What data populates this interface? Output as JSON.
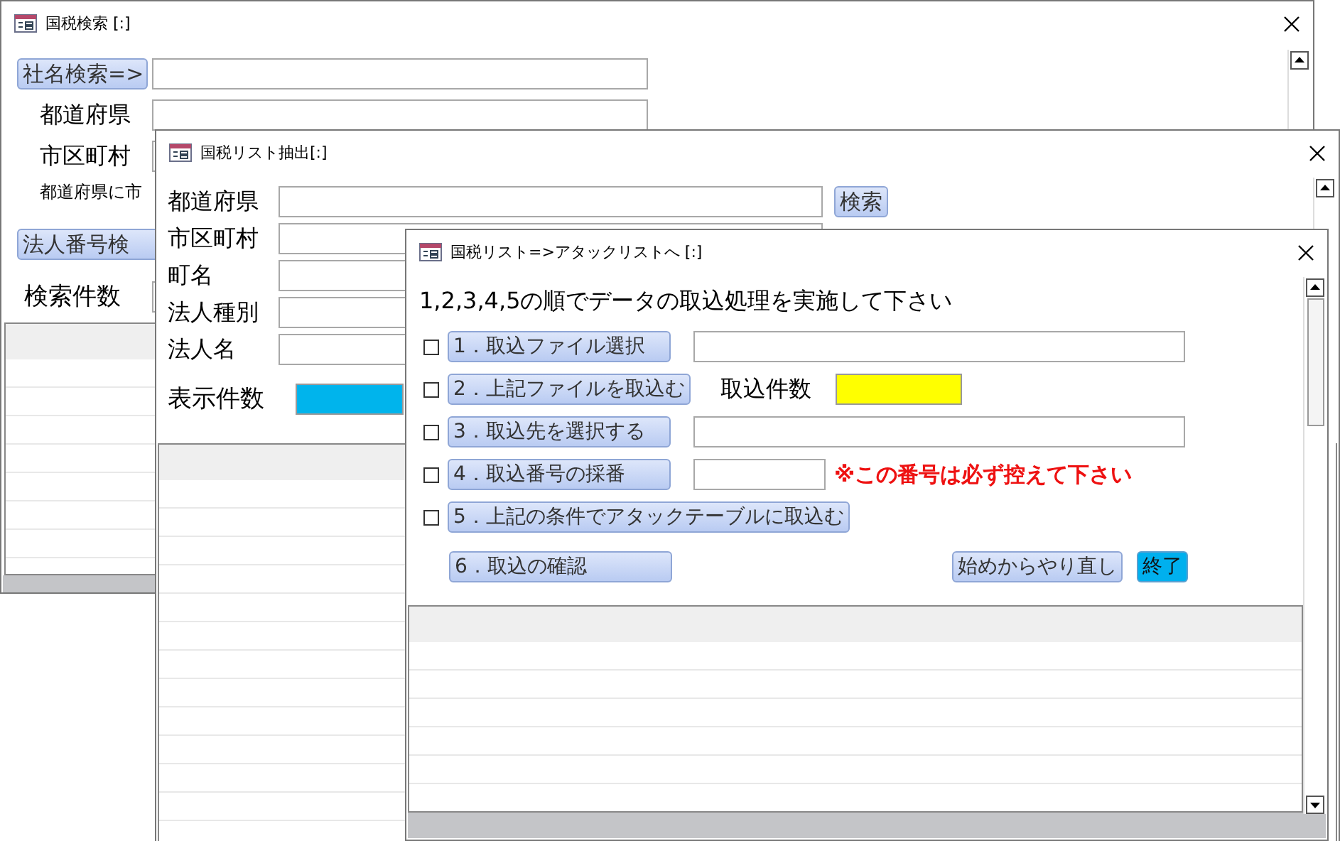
{
  "search_window": {
    "title": "国税検索 [:]",
    "company_search_button": "社名検索=>",
    "fields": [
      {
        "label": "都道府県"
      },
      {
        "label": "市区町村"
      }
    ],
    "note": "都道府県に市",
    "corporate_number_button": "法人番号検",
    "count_label": "検索件数"
  },
  "extract_window": {
    "title": "国税リスト抽出[:]",
    "fields": [
      {
        "label": "都道府県"
      },
      {
        "label": "市区町村"
      },
      {
        "label": "町名"
      },
      {
        "label": "法人種別"
      },
      {
        "label": "法人名"
      }
    ],
    "search_button": "検索",
    "count_label": "表示件数"
  },
  "import_window": {
    "title": "国税リスト=>アタックリストへ [:]",
    "instruction": "1,2,3,4,5の順でデータの取込処理を実施して下さい",
    "steps": [
      {
        "label": "1．取込ファイル選択",
        "checked": false,
        "kind": "field"
      },
      {
        "label": "2．上記ファイルを取込む",
        "checked": false,
        "kind": "count",
        "count_label": "取込件数"
      },
      {
        "label": "3．取込先を選択する",
        "checked": false,
        "kind": "field"
      },
      {
        "label": "4．取込番号の採番",
        "checked": false,
        "kind": "number",
        "note": "※この番号は必ず控えて下さい"
      },
      {
        "label": "5．上記の条件でアタックテーブルに取込む",
        "checked": false,
        "kind": "plain"
      }
    ],
    "confirm_button": "6．取込の確認",
    "restart_button": "始めからやり直し",
    "exit_button": "終了"
  }
}
